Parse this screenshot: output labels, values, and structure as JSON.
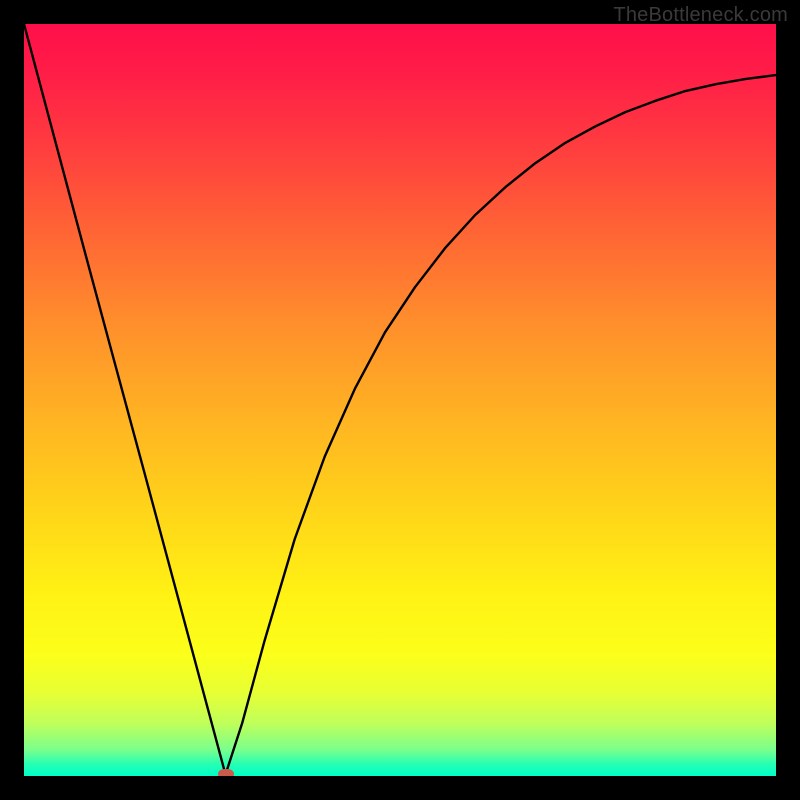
{
  "watermark": "TheBottleneck.com",
  "marker": {
    "x_frac": 0.268,
    "y_frac": 0.998,
    "color": "#cc5a4a"
  },
  "chart_data": {
    "type": "line",
    "title": "",
    "xlabel": "",
    "ylabel": "",
    "xlim": [
      0,
      1
    ],
    "ylim": [
      0,
      1
    ],
    "legend": false,
    "grid": false,
    "annotations": [
      "TheBottleneck.com"
    ],
    "background_gradient": {
      "orientation": "vertical",
      "top_color": "#ff0f4a",
      "bottom_color": "#00ffc9",
      "meaning": "red high / green low vertical heat gradient"
    },
    "series": [
      {
        "name": "curve",
        "x": [
          0.0,
          0.04,
          0.08,
          0.12,
          0.16,
          0.2,
          0.24,
          0.268,
          0.29,
          0.32,
          0.36,
          0.4,
          0.44,
          0.48,
          0.52,
          0.56,
          0.6,
          0.64,
          0.68,
          0.72,
          0.76,
          0.8,
          0.84,
          0.88,
          0.92,
          0.96,
          1.0
        ],
        "y": [
          1.0,
          0.85,
          0.7,
          0.552,
          0.404,
          0.255,
          0.106,
          0.002,
          0.07,
          0.18,
          0.315,
          0.425,
          0.515,
          0.59,
          0.65,
          0.702,
          0.746,
          0.783,
          0.815,
          0.842,
          0.864,
          0.883,
          0.898,
          0.911,
          0.92,
          0.927,
          0.932
        ]
      }
    ],
    "marker_point": {
      "x": 0.268,
      "y": 0.002
    }
  }
}
